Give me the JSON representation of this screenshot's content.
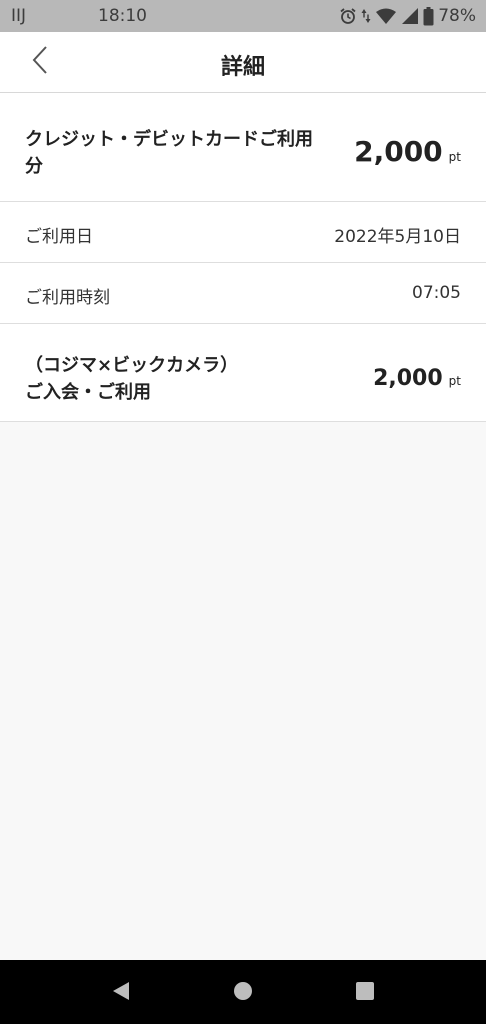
{
  "status_bar": {
    "carrier": "IIJ",
    "time": "18:10",
    "battery": "78%",
    "icons": [
      "alarm-icon",
      "data-arrows-icon",
      "wifi-icon",
      "signal-icon",
      "battery-icon"
    ]
  },
  "header": {
    "title": "詳細",
    "back_icon": "chevron-left-icon"
  },
  "summary": {
    "label": "クレジット・デビットカードご利用分",
    "points": "2,000",
    "unit": "pt"
  },
  "details": [
    {
      "label": "ご利用日",
      "value": "2022年5月10日"
    },
    {
      "label": "ご利用時刻",
      "value": "07:05"
    }
  ],
  "item": {
    "label": "（コジマ×ビックカメラ）ご入会・ご利用",
    "points": "2,000",
    "unit": "pt"
  },
  "nav_bar": {
    "buttons": [
      "back-triangle-icon",
      "home-circle-icon",
      "recents-square-icon"
    ]
  },
  "colors": {
    "status_bar_bg": "#b8b8b8",
    "page_bg": "#f8f8f8",
    "card_bg": "#ffffff",
    "divider": "#dedede",
    "nav_bar_bg": "#000000"
  }
}
